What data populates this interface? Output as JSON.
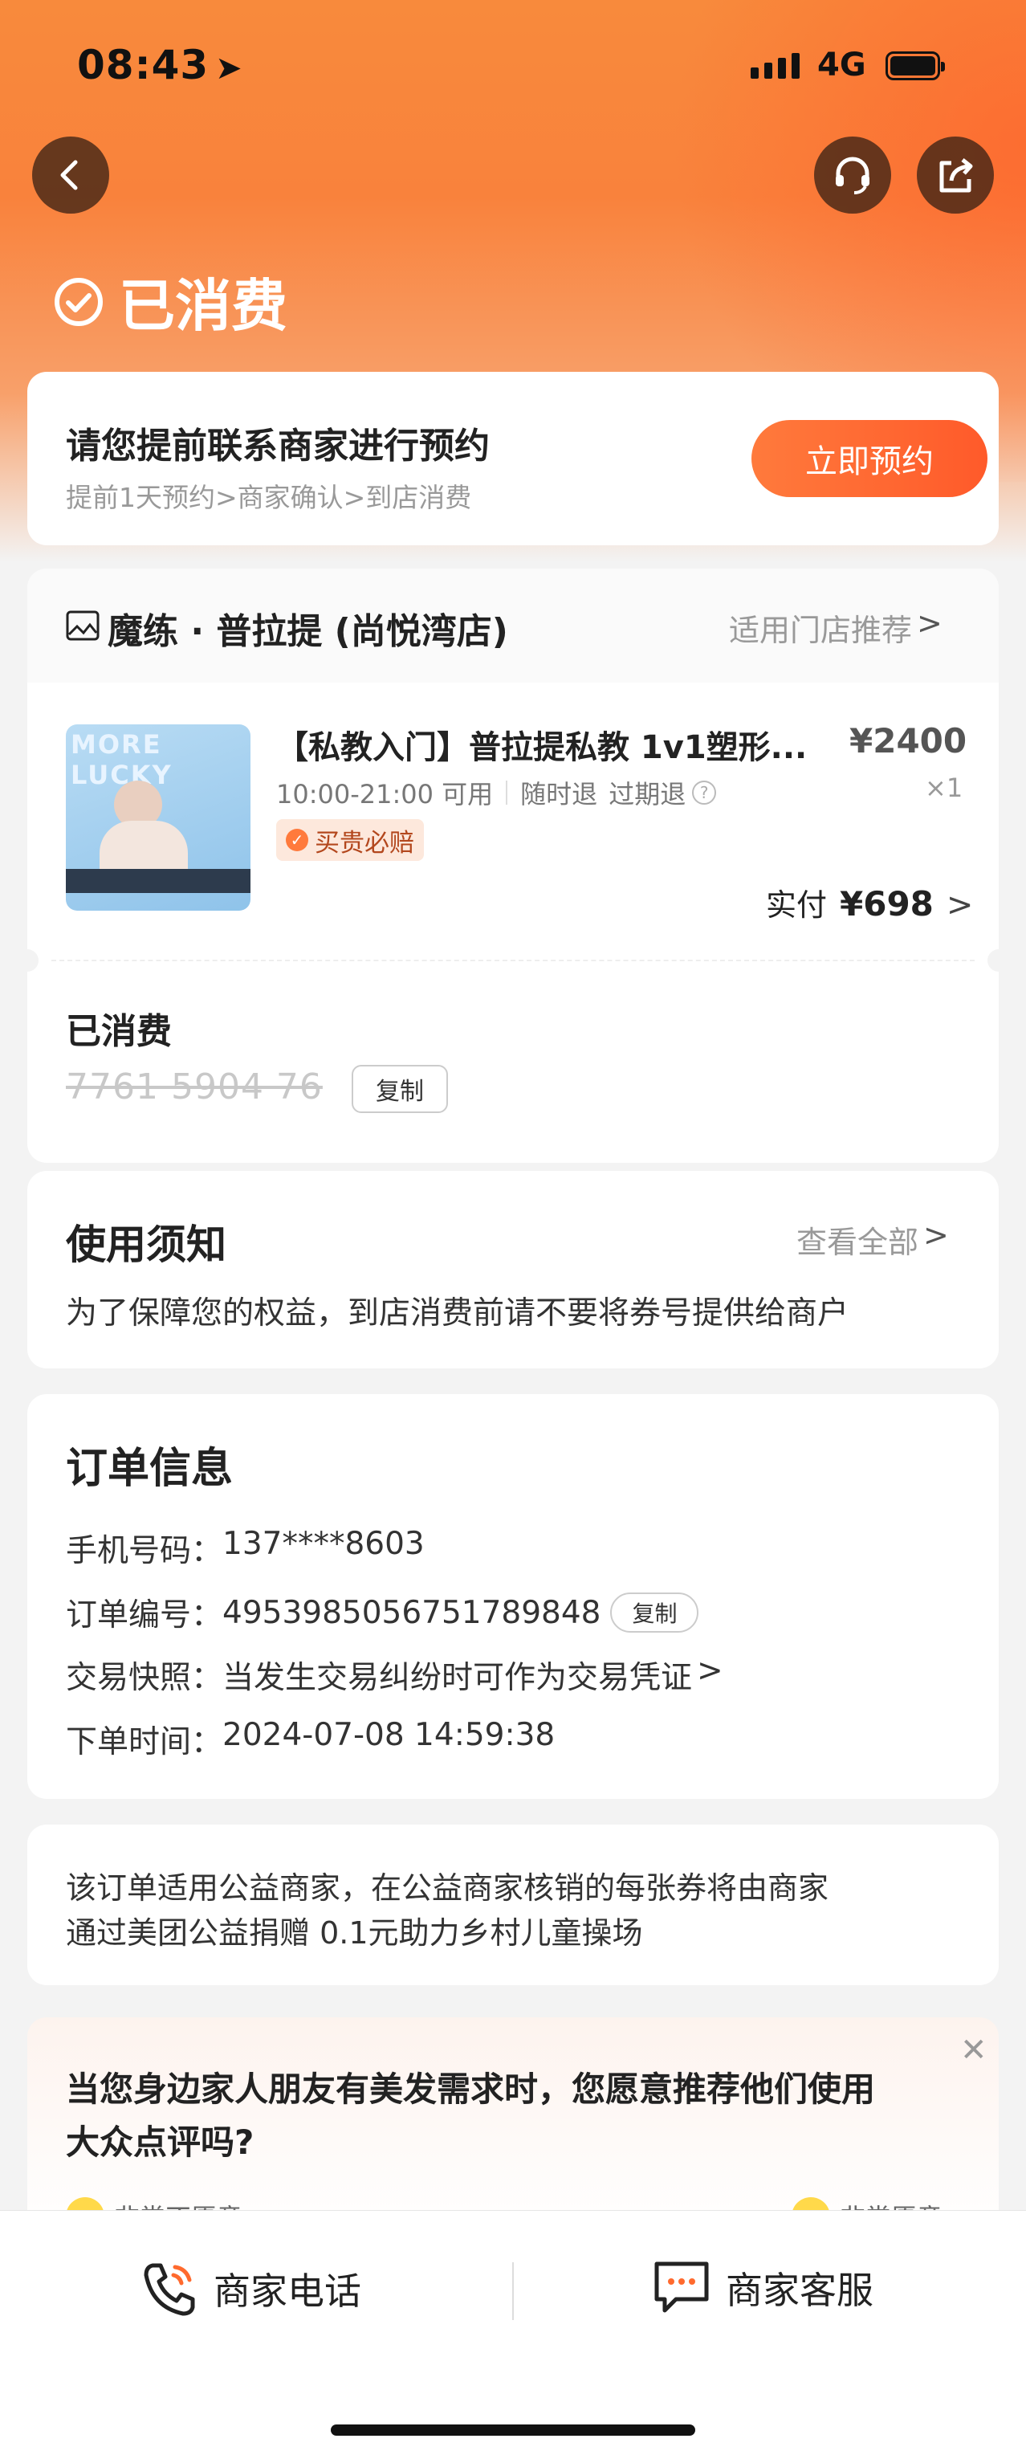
{
  "status_bar": {
    "time": "08:43",
    "network": "4G"
  },
  "header": {
    "status_title": "已消费"
  },
  "reservation": {
    "title": "请您提前联系商家进行预约",
    "steps": "提前1天预约>商家确认>到店消费",
    "button": "立即预约"
  },
  "store": {
    "name": "魔练 · 普拉提 (尚悦湾店)",
    "link": "适用门店推荐",
    "chevron": ">"
  },
  "product": {
    "image_text": "MORE LUCKY",
    "title": "【私教入门】普拉提私教 1v1塑形...",
    "price": "¥2400",
    "quantity": "×1",
    "hours": "10:00-21:00 可用",
    "refund_anytime": "随时退",
    "refund_expired": "过期退",
    "badge": "买贵必赔",
    "paid_label": "实付",
    "paid_amount": "¥698"
  },
  "voucher": {
    "status": "已消费",
    "code": "7761 5904 76",
    "copy": "复制"
  },
  "notice": {
    "title": "使用须知",
    "link": "查看全部",
    "text": "为了保障您的权益，到店消费前请不要将券号提供给商户"
  },
  "order": {
    "title": "订单信息",
    "phone_label": "手机号码：",
    "phone": "137****8603",
    "number_label": "订单编号：",
    "number": "4953985056751789848",
    "copy": "复制",
    "snapshot_label": "交易快照：",
    "snapshot": "当发生交易纠纷时可作为交易凭证",
    "time_label": "下单时间：",
    "time": "2024-07-08 14:59:38"
  },
  "charity": {
    "line1": "该订单适用公益商家，在公益商家核销的每张券将由商家",
    "line2": "通过美团公益捐赠 0.1元助力乡村儿童操场"
  },
  "survey": {
    "line1": "当您身边家人朋友有美发需求时，您愿意推荐他们使用",
    "line2": "大众点评吗?",
    "left": "非常不愿意",
    "right": "非常愿意"
  },
  "bottom": {
    "phone_label": "商家电话",
    "service_label": "商家客服"
  },
  "colors": {
    "accent": "#ff6a2e",
    "hero": "#f88a3c"
  }
}
